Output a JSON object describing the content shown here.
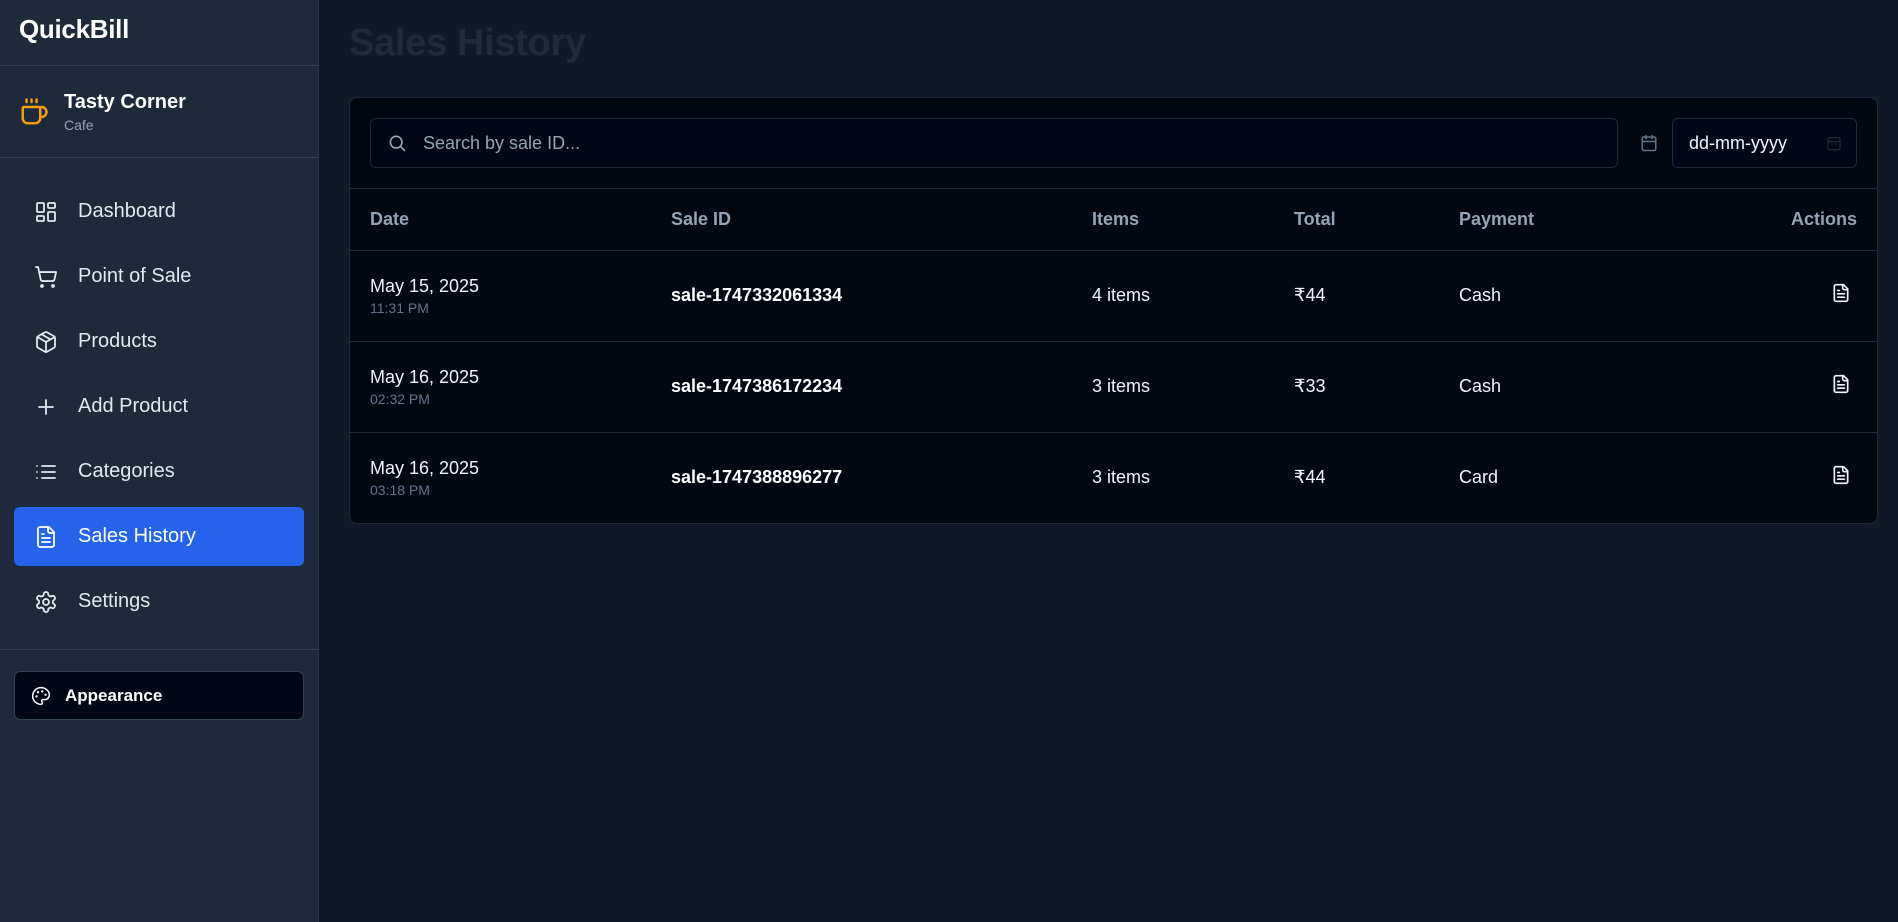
{
  "app": {
    "name": "QuickBill"
  },
  "store": {
    "name": "Tasty Corner",
    "type": "Cafe",
    "icon": "coffee-cup-icon",
    "icon_color": "#f59e0b"
  },
  "nav": {
    "items": [
      {
        "label": "Dashboard",
        "icon": "dashboard-icon"
      },
      {
        "label": "Point of Sale",
        "icon": "cart-icon"
      },
      {
        "label": "Products",
        "icon": "box-icon"
      },
      {
        "label": "Add Product",
        "icon": "plus-icon"
      },
      {
        "label": "Categories",
        "icon": "list-icon"
      },
      {
        "label": "Sales History",
        "icon": "document-icon",
        "active": true
      },
      {
        "label": "Settings",
        "icon": "gear-icon"
      }
    ],
    "active_color": "#2563eb"
  },
  "appearance": {
    "label": "Appearance",
    "icon": "palette-icon"
  },
  "page": {
    "title": "Sales History"
  },
  "search": {
    "placeholder": "Search by sale ID..."
  },
  "date_filter": {
    "placeholder": "dd-mm-yyyy"
  },
  "table": {
    "headers": {
      "date": "Date",
      "sale_id": "Sale ID",
      "items": "Items",
      "total": "Total",
      "payment": "Payment",
      "actions": "Actions"
    },
    "rows": [
      {
        "date": "May 15, 2025",
        "time": "11:31 PM",
        "sale_id": "sale-1747332061334",
        "items": "4 items",
        "total": "₹44",
        "payment": "Cash"
      },
      {
        "date": "May 16, 2025",
        "time": "02:32 PM",
        "sale_id": "sale-1747386172234",
        "items": "3 items",
        "total": "₹33",
        "payment": "Cash"
      },
      {
        "date": "May 16, 2025",
        "time": "03:18 PM",
        "sale_id": "sale-1747388896277",
        "items": "3 items",
        "total": "₹44",
        "payment": "Card"
      }
    ]
  }
}
